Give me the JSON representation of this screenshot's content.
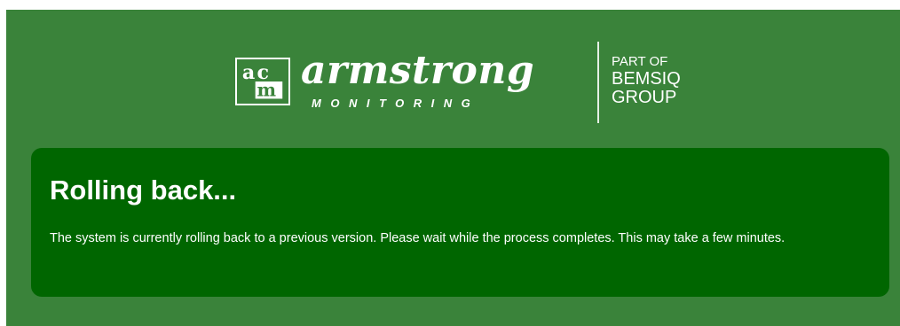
{
  "logo": {
    "mark_letters": "acm",
    "wordmark": "armstrong",
    "subtitle": "MONITORING",
    "group_line1": "PART OF",
    "group_line2": "BEMSIQ",
    "group_line3": "GROUP"
  },
  "status": {
    "title": "Rolling back...",
    "message": "The system is currently rolling back to a previous version. Please wait while the process completes. This may take a few minutes."
  },
  "colors": {
    "page_background": "#3a833a",
    "panel_background": "#006600",
    "text": "#ffffff"
  }
}
